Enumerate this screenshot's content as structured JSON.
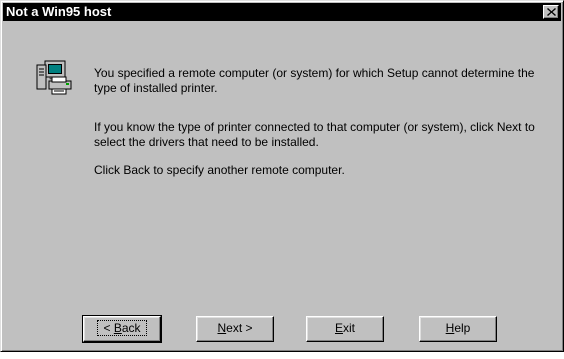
{
  "window": {
    "title": "Not a Win95 host"
  },
  "message": {
    "line1": "You specified a remote computer (or system) for which Setup cannot determine the type of installed printer.",
    "line2": "If you know the type of printer connected to that computer (or system), click Next to select the drivers that need to be installed.",
    "line3": "Click Back to specify another remote computer."
  },
  "buttons": {
    "back": {
      "pre": "< ",
      "accel": "B",
      "post": "ack"
    },
    "next": {
      "pre": "",
      "accel": "N",
      "post": "ext >"
    },
    "exit": {
      "pre": "",
      "accel": "E",
      "post": "xit"
    },
    "help": {
      "pre": "",
      "accel": "H",
      "post": "elp"
    }
  },
  "icons": {
    "main": "computer-printer-icon",
    "close": "close-icon"
  },
  "colors": {
    "dialog_bg": "#c0c0c0",
    "titlebar": "#000000"
  }
}
